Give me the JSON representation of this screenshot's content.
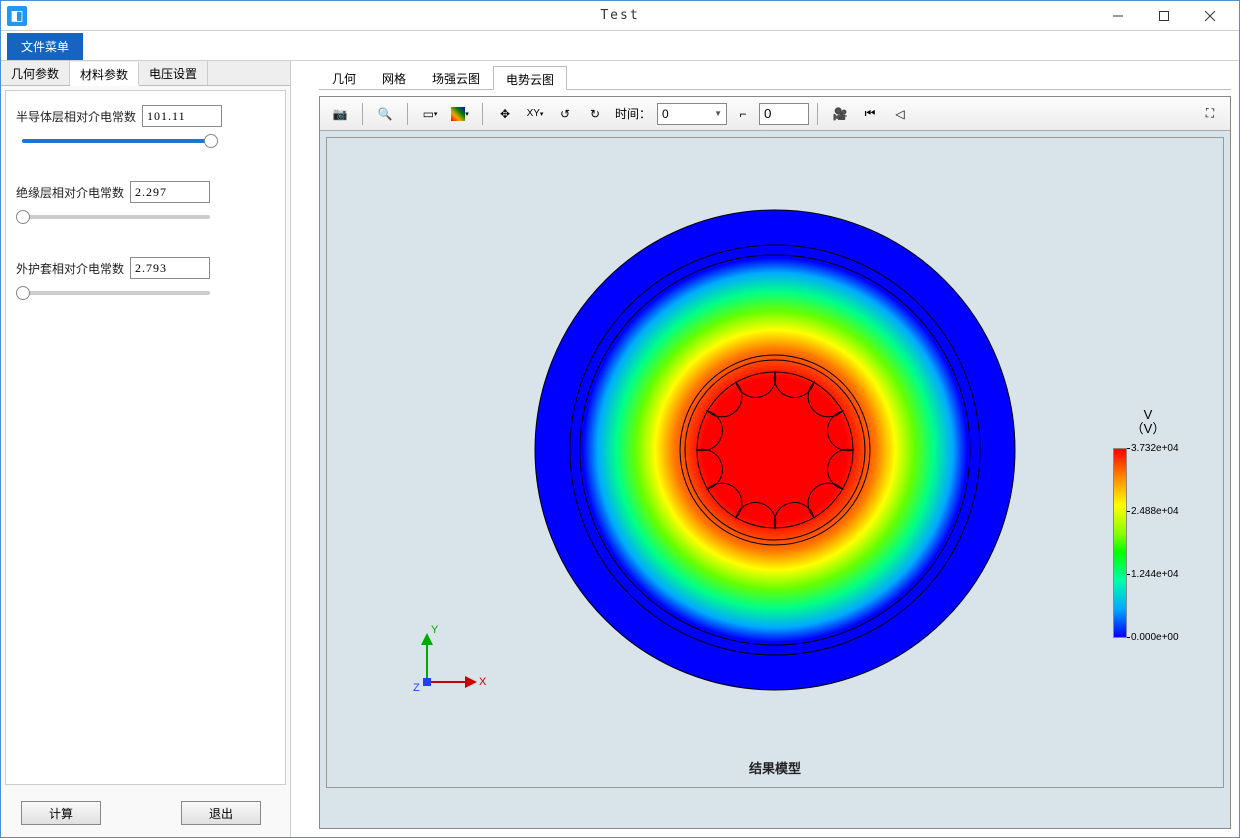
{
  "window": {
    "title": "Test"
  },
  "menu": {
    "file_menu_label": "文件菜单"
  },
  "left_tabs": [
    "几何参数",
    "材料参数",
    "电压设置"
  ],
  "left_active_tab_index": 1,
  "params": [
    {
      "label": "半导体层相对介电常数",
      "value": "101.11",
      "slider_pos": 0.96,
      "track_blue": true
    },
    {
      "label": "绝缘层相对介电常数",
      "value": "2.297",
      "slider_pos": 0.02,
      "track_blue": false
    },
    {
      "label": "外护套相对介电常数",
      "value": "2.793",
      "slider_pos": 0.02,
      "track_blue": false
    }
  ],
  "buttons": {
    "compute": "计算",
    "exit": "退出"
  },
  "right_tabs": [
    "几何",
    "网格",
    "场强云图",
    "电势云图"
  ],
  "right_active_tab_index": 3,
  "toolbar": {
    "time_label": "时间：",
    "time_select_value": "0",
    "time_input_value": "0"
  },
  "plot": {
    "title": "结果模型",
    "axis": {
      "x": "X",
      "y": "Y",
      "z": "Z"
    },
    "scalebar": {
      "title_line1": "V",
      "title_line2": "（V）",
      "max": "3.732e+04",
      "mid_high": "2.488e+04",
      "mid_low": "1.244e+04",
      "min": "0.000e+00"
    }
  },
  "chart_data": {
    "type": "heatmap",
    "geometry": "concentric-circles-cross-section",
    "field_variable": "V (Electric Potential)",
    "unit": "V",
    "value_range_min": 0.0,
    "value_range_max": 37320.0,
    "colorbar_ticks": [
      0.0,
      12440.0,
      24880.0,
      37320.0
    ],
    "colormap": "rainbow (blue-low, red-high)",
    "radial_profile_estimate": [
      {
        "r_normalized": 0.0,
        "value": 37320
      },
      {
        "r_normalized": 0.3,
        "value": 37320
      },
      {
        "r_normalized": 0.45,
        "value": 30000
      },
      {
        "r_normalized": 0.55,
        "value": 20000
      },
      {
        "r_normalized": 0.65,
        "value": 10000
      },
      {
        "r_normalized": 0.75,
        "value": 0
      },
      {
        "r_normalized": 1.0,
        "value": 0
      }
    ]
  }
}
